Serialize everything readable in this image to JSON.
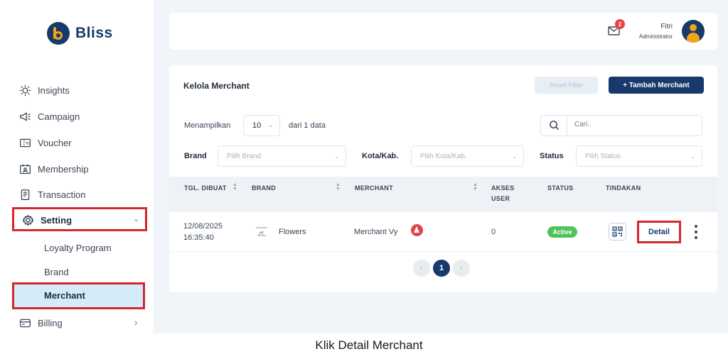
{
  "app": {
    "name": "Bliss",
    "accent": "#173a6b",
    "brand_accent": "#f2a417",
    "highlight": "#d5262f"
  },
  "sidebar": {
    "items": [
      {
        "label": "Insights",
        "icon": "insights-icon"
      },
      {
        "label": "Campaign",
        "icon": "megaphone-icon"
      },
      {
        "label": "Voucher",
        "icon": "voucher-icon"
      },
      {
        "label": "Membership",
        "icon": "membership-icon"
      },
      {
        "label": "Transaction",
        "icon": "receipt-icon"
      },
      {
        "label": "Setting",
        "icon": "gear-icon",
        "expanded": true
      },
      {
        "label": "Billing",
        "icon": "billing-icon"
      }
    ],
    "setting_sub": [
      "Loyalty Program",
      "Brand",
      "Merchant"
    ],
    "active_sub": "Merchant"
  },
  "header": {
    "notifications": "2",
    "user_name": "Fitri",
    "user_role": "Administrator"
  },
  "page": {
    "title": "Kelola Merchant",
    "reset_label": "Reset Filter",
    "add_label": "+ Tambah Merchant",
    "show_label": "Menampilkan",
    "page_size": "10",
    "of_label": "dari 1 data",
    "search_placeholder": "Cari..",
    "filters": {
      "brand_label": "Brand",
      "brand_placeholder": "Pilih Brand",
      "city_label": "Kota/Kab.",
      "city_placeholder": "Pilih Kota/Kab.",
      "status_label": "Status",
      "status_placeholder": "Pilih Status"
    }
  },
  "table": {
    "headers": [
      "TGL. DIBUAT",
      "BRAND",
      "MERCHANT",
      "AKSES USER",
      "STATUS",
      "TINDAKAN"
    ],
    "headers_split": {
      "akses_1": "AKSES",
      "akses_2": "USER"
    },
    "rows": [
      {
        "date": "12/08/2025",
        "time": "16:35:40",
        "brand": "Flowers",
        "merchant": "Merchant Vy",
        "access": "0",
        "status": "Active",
        "action": "Detail"
      }
    ]
  },
  "pagination": {
    "current": "1",
    "prev": "‹",
    "next": "›"
  },
  "caption": "Klik Detail Merchant"
}
